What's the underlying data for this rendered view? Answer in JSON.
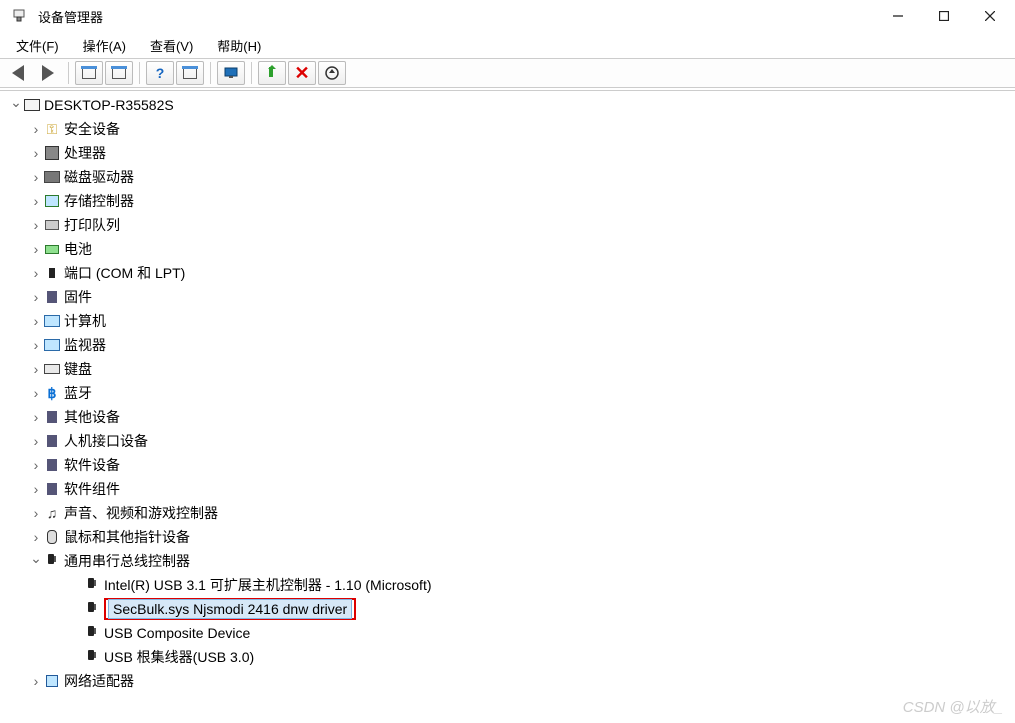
{
  "window": {
    "title": "设备管理器"
  },
  "menu": {
    "file": "文件(F)",
    "action": "操作(A)",
    "view": "查看(V)",
    "help": "帮助(H)"
  },
  "tree": {
    "root": "DESKTOP-R35582S",
    "categories": [
      {
        "label": "安全设备",
        "icon": "ico-key"
      },
      {
        "label": "处理器",
        "icon": "ico-chip"
      },
      {
        "label": "磁盘驱动器",
        "icon": "ico-disk"
      },
      {
        "label": "存储控制器",
        "icon": "ico-storage"
      },
      {
        "label": "打印队列",
        "icon": "ico-printer"
      },
      {
        "label": "电池",
        "icon": "ico-battery"
      },
      {
        "label": "端口 (COM 和 LPT)",
        "icon": "ico-port"
      },
      {
        "label": "固件",
        "icon": "ico-generic"
      },
      {
        "label": "计算机",
        "icon": "ico-monitor"
      },
      {
        "label": "监视器",
        "icon": "ico-monitor"
      },
      {
        "label": "键盘",
        "icon": "ico-keyboard"
      },
      {
        "label": "蓝牙",
        "icon": "ico-bt"
      },
      {
        "label": "其他设备",
        "icon": "ico-generic"
      },
      {
        "label": "人机接口设备",
        "icon": "ico-generic"
      },
      {
        "label": "软件设备",
        "icon": "ico-generic"
      },
      {
        "label": "软件组件",
        "icon": "ico-generic"
      },
      {
        "label": "声音、视频和游戏控制器",
        "icon": "ico-sound"
      },
      {
        "label": "鼠标和其他指针设备",
        "icon": "ico-mouse"
      },
      {
        "label": "通用串行总线控制器",
        "icon": "ico-usb",
        "expanded": true,
        "children": [
          {
            "label": "Intel(R) USB 3.1 可扩展主机控制器 - 1.10 (Microsoft)"
          },
          {
            "label": "SecBulk.sys Njsmodi 2416 dnw driver",
            "selected": true
          },
          {
            "label": "USB Composite Device"
          },
          {
            "label": "USB 根集线器(USB 3.0)"
          }
        ]
      },
      {
        "label": "网络适配器",
        "icon": "ico-net"
      }
    ]
  },
  "watermark": "CSDN @以放_"
}
